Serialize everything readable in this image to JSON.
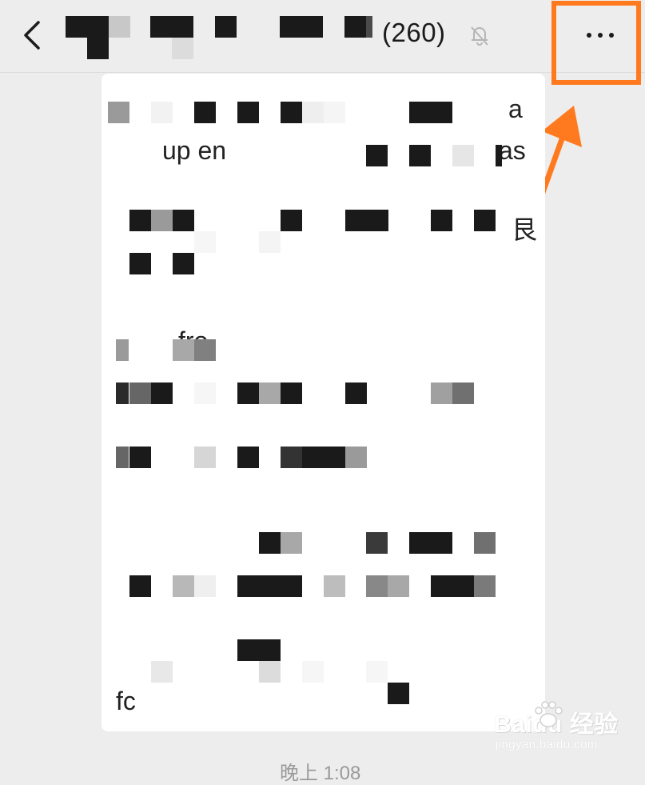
{
  "header": {
    "title_count": "(260)",
    "back_icon": "chevron-left-icon",
    "mute_icon": "bell-off-icon",
    "more_icon": "more-dots-icon",
    "more_label": "···"
  },
  "message": {
    "fragments": [
      "a",
      "up en",
      "as",
      "艮",
      "fro",
      "fc"
    ]
  },
  "annotation": {
    "color": "#ff7a1f"
  },
  "footer": {
    "time": "晚上 1:08"
  },
  "watermark": {
    "logo": "Baidu 经验",
    "url": "jingyan.baidu.com"
  }
}
